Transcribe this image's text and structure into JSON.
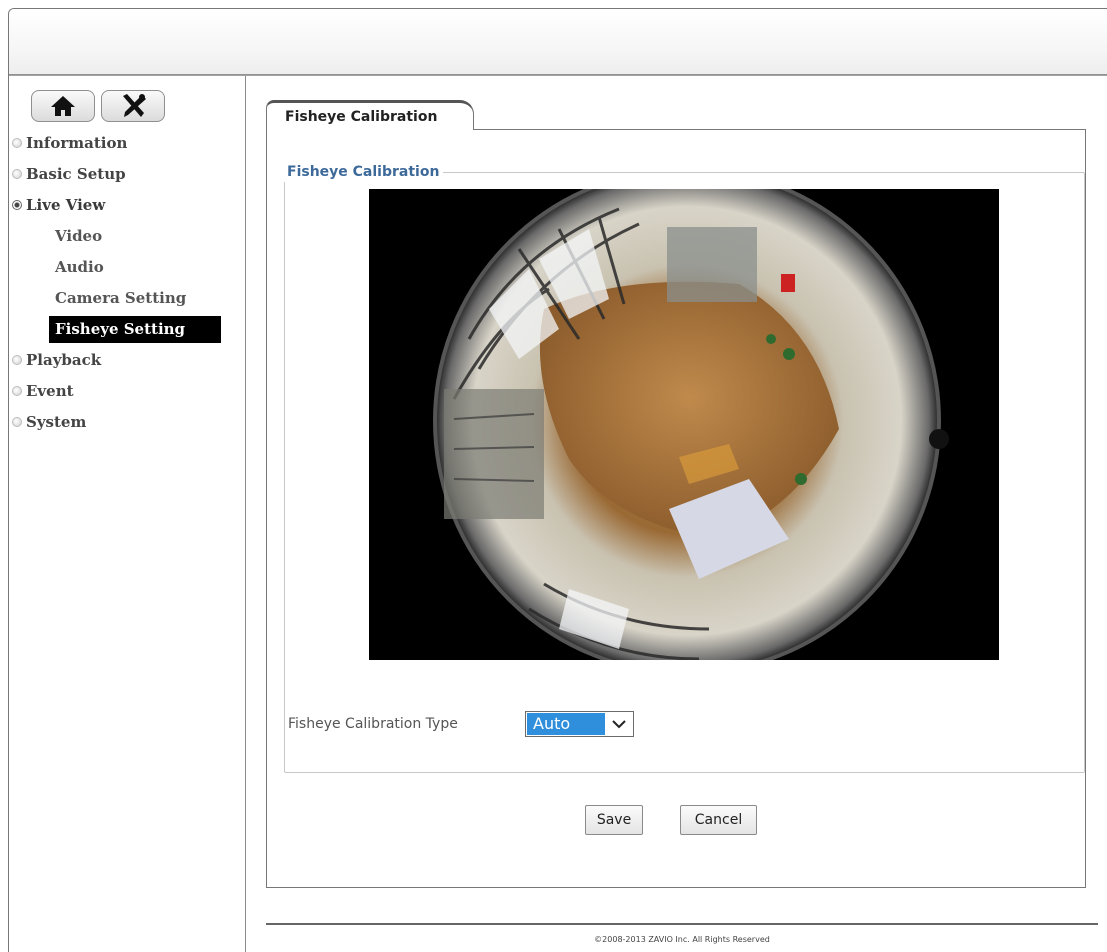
{
  "sidebar": {
    "buttons": [
      {
        "icon": "home-icon"
      },
      {
        "icon": "tools-icon"
      }
    ],
    "items": [
      {
        "label": "Information",
        "state": "collapsed"
      },
      {
        "label": "Basic Setup",
        "state": "collapsed"
      },
      {
        "label": "Live View",
        "state": "expanded",
        "children": [
          "Video",
          "Audio",
          "Camera Setting",
          "Fisheye Setting"
        ],
        "active_child": "Fisheye Setting"
      },
      {
        "label": "Playback",
        "state": "collapsed"
      },
      {
        "label": "Event",
        "state": "collapsed"
      },
      {
        "label": "System",
        "state": "collapsed"
      }
    ]
  },
  "main": {
    "tab_label": "Fisheye Calibration",
    "section_legend": "Fisheye Calibration",
    "viewer": {
      "content": "fisheye-camera-live-image"
    },
    "calibration_type": {
      "label": "Fisheye Calibration Type",
      "selected": "Auto"
    },
    "buttons": {
      "save": "Save",
      "cancel": "Cancel"
    }
  },
  "footer": {
    "copyright": "©2008-2013 ZAVIO Inc. All Rights Reserved"
  },
  "colors": {
    "active_nav_bg": "#000000",
    "legend_text": "#3e6a9a",
    "select_highlight": "#2f8fdc"
  }
}
